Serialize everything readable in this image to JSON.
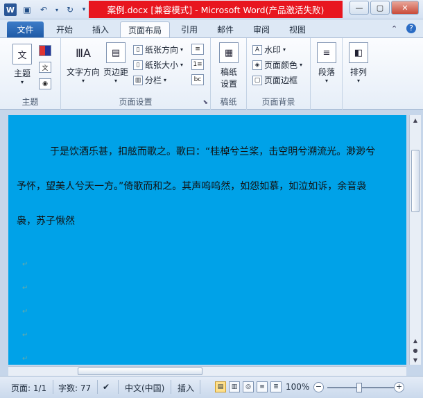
{
  "titlebar": {
    "title": "案例.docx [兼容模式] - Microsoft Word(产品激活失败)",
    "logo": "W"
  },
  "tabs": [
    {
      "label": "文件"
    },
    {
      "label": "开始"
    },
    {
      "label": "插入"
    },
    {
      "label": "页面布局"
    },
    {
      "label": "引用"
    },
    {
      "label": "邮件"
    },
    {
      "label": "审阅"
    },
    {
      "label": "视图"
    }
  ],
  "ribbon": {
    "theme": {
      "label": "主题",
      "group": "主题"
    },
    "page_setup": {
      "text_direction": "文字方向",
      "margins": "页边距",
      "orientation": "纸张方向",
      "size": "纸张大小",
      "columns": "分栏",
      "group": "页面设置"
    },
    "draft": {
      "label": "稿纸\n设置",
      "label1": "稿纸",
      "label2": "设置",
      "group": "稿纸"
    },
    "background": {
      "watermark": "水印",
      "page_color": "页面颜色",
      "page_border": "页面边框",
      "group": "页面背景"
    },
    "paragraph": "段落",
    "arrange": "排列"
  },
  "document": {
    "line1": "于是饮酒乐甚，扣舷而歌之。歌曰：“桂棹兮兰桨，击空明兮溯流光。渺渺兮",
    "line2": "予怀，望美人兮天一方。”倚歌而和之。其声呜呜然，如怨如慕，如泣如诉，余音袅",
    "line3": "袅，苏子愀然",
    "page_color": "#00a2e8"
  },
  "statusbar": {
    "page": "页面: 1/1",
    "words": "字数: 77",
    "language": "中文(中国)",
    "mode": "插入",
    "zoom": "100%"
  }
}
